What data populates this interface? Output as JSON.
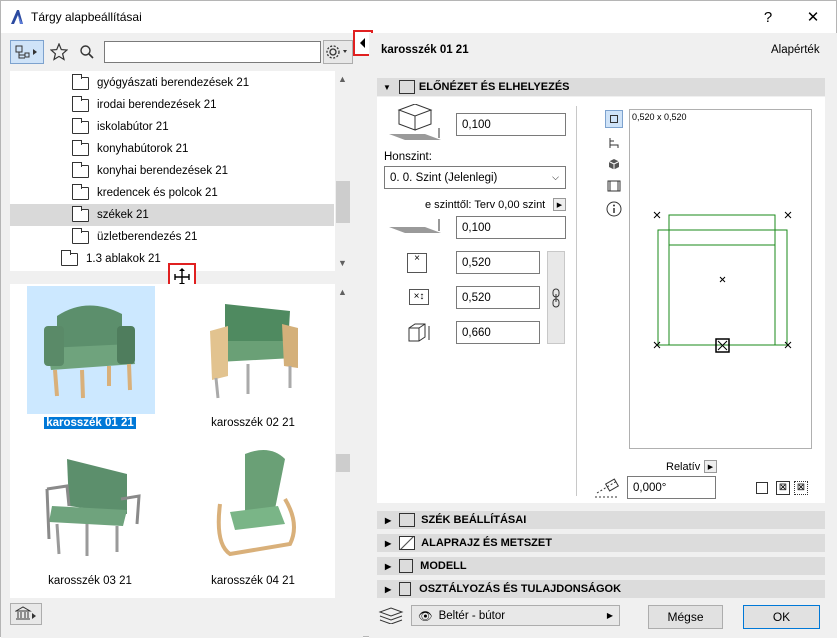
{
  "window": {
    "title": "Tárgy alapbeállításai",
    "help": "?",
    "close": "✕"
  },
  "library": {
    "search_value": "",
    "tree": [
      {
        "label": "gyógyászati berendezések 21",
        "selected": false
      },
      {
        "label": "irodai berendezések 21",
        "selected": false
      },
      {
        "label": "iskolabútor 21",
        "selected": false
      },
      {
        "label": "konyhabútorok 21",
        "selected": false
      },
      {
        "label": "konyhai berendezések 21",
        "selected": false
      },
      {
        "label": "kredencek és polcok 21",
        "selected": false
      },
      {
        "label": "székek 21",
        "selected": true
      },
      {
        "label": "üzletberendezés 21",
        "selected": false
      },
      {
        "label": "1.3 ablakok 21",
        "selected": false
      }
    ],
    "items": [
      {
        "label": "karosszék 01 21",
        "selected": true
      },
      {
        "label": "karosszék 02 21",
        "selected": false
      },
      {
        "label": "karosszék 03 21",
        "selected": false
      },
      {
        "label": "karosszék 04 21",
        "selected": false
      }
    ]
  },
  "header": {
    "object_name": "karosszék 01 21",
    "defaults_label": "Alapérték"
  },
  "preview_section": {
    "title": "ELŐNÉZET ÉS ELHELYEZÉS",
    "top_offset": "0,100",
    "story_label": "Honszint:",
    "story_value": "0. 0. Szint (Jelenlegi)",
    "from_story_label": "e szinttől: Terv 0,00 szint",
    "elevation": "0,100",
    "width": "0,520",
    "depth": "0,520",
    "height": "0,660",
    "preview_size_label": "0,520 x 0,520",
    "relative_label": "Relatív",
    "angle": "0,000°"
  },
  "sections": [
    {
      "title": "SZÉK BEÁLLÍTÁSAI"
    },
    {
      "title": "ALAPRAJZ ÉS METSZET"
    },
    {
      "title": "MODELL"
    },
    {
      "title": "OSZTÁLYOZÁS ÉS TULAJDONSÁGOK"
    }
  ],
  "footer": {
    "layer_value": "Beltér - bútor",
    "cancel": "Mégse",
    "ok": "OK"
  },
  "colors": {
    "selection": "#cce8ff",
    "label_highlight": "#0078d7",
    "plan_green": "#1a8a1a",
    "annotation_red": "#e02020"
  }
}
